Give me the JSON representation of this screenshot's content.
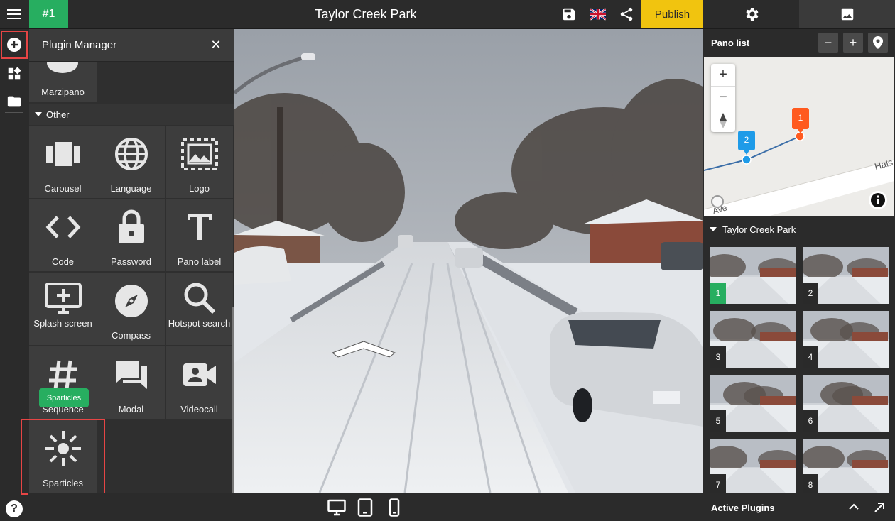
{
  "topbar": {
    "tour_id": "#1",
    "title": "Taylor Creek Park",
    "publish_label": "Publish"
  },
  "plugin_panel": {
    "title": "Plugin Manager",
    "close_glyph": "✕",
    "top_tile": {
      "label": "Marzipano",
      "icon": "marzipano-icon"
    },
    "section_label": "Other",
    "tiles": [
      {
        "label": "Carousel",
        "icon": "carousel-icon"
      },
      {
        "label": "Language",
        "icon": "globe-icon"
      },
      {
        "label": "Logo",
        "icon": "logo-icon"
      },
      {
        "label": "Code",
        "icon": "code-icon"
      },
      {
        "label": "Password",
        "icon": "lock-icon"
      },
      {
        "label": "Pano label",
        "icon": "text-icon"
      },
      {
        "label": "Splash screen",
        "icon": "splash-screen-icon"
      },
      {
        "label": "Compass",
        "icon": "compass-icon"
      },
      {
        "label": "Hotspot search",
        "icon": "search-icon"
      },
      {
        "label": "Sequence",
        "icon": "hash-icon"
      },
      {
        "label": "Modal",
        "icon": "modal-icon"
      },
      {
        "label": "Videocall",
        "icon": "video-camera-icon"
      },
      {
        "label": "Sparticles",
        "icon": "sparkle-icon"
      }
    ],
    "drag_tooltip": "Sparticles"
  },
  "right_panel": {
    "pano_list_title": "Pano list",
    "map": {
      "street_label_1": "Hals",
      "street_label_2": "Ave",
      "markers": [
        "1",
        "2"
      ]
    },
    "group_title": "Taylor Creek Park",
    "thumbnails": [
      "1",
      "2",
      "3",
      "4",
      "5",
      "6",
      "7",
      "8"
    ],
    "selected_thumbnail": "1",
    "active_plugins_label": "Active Plugins"
  },
  "colors": {
    "accent_green": "#27ae60",
    "publish_yellow": "#f1c40f",
    "highlight_red": "#e64545",
    "marker_orange": "#ff5a1f",
    "marker_blue": "#1e9be8"
  }
}
